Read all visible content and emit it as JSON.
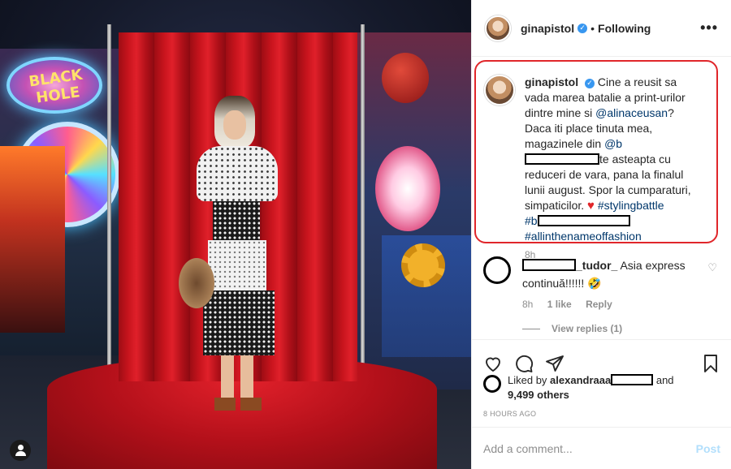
{
  "header": {
    "username": "ginapistol",
    "separator": "•",
    "follow_status": "Following",
    "more": "•••"
  },
  "caption": {
    "username": "ginapistol",
    "text_1": "Cine a reusit sa vada marea batalie a print-urilor dintre mine si",
    "mention_1": "@alinaceusan",
    "text_2": "? Daca iti place tinuta mea, magazinele din",
    "mention_2_prefix": "@b",
    "text_3": "te asteapta cu reduceri de vara, pana la finalul lunii august. Spor la cumparaturi, simpaticilor.",
    "heart": "♥",
    "hashtag_1": "#stylingbattle",
    "hashtag_2_prefix": "#b",
    "hashtag_3": "#allinthenameoffashion",
    "time": "8h"
  },
  "comment": {
    "username_suffix": "_tudor_",
    "text": "Asia express continuă!!!!!! 🤣",
    "time": "8h",
    "likes": "1 like",
    "reply": "Reply",
    "view_replies": "View replies (1)"
  },
  "likes": {
    "prefix": "Liked by",
    "username_prefix": "alexandraaa",
    "and": "and",
    "others": "9,499 others"
  },
  "time_ago": "8 HOURS AGO",
  "comment_bar": {
    "placeholder": "Add a comment...",
    "post": "Post"
  },
  "photo": {
    "sign_text": "BLACK HOLE"
  },
  "colors": {
    "highlight_border": "#e0262a",
    "link": "#00376b",
    "verified": "#3897f0",
    "post_disabled": "#b2dffc"
  },
  "icons": [
    "verified-badge-icon",
    "more-options-icon",
    "heart-icon",
    "comment-icon",
    "share-icon",
    "bookmark-icon",
    "profile-user-icon"
  ]
}
